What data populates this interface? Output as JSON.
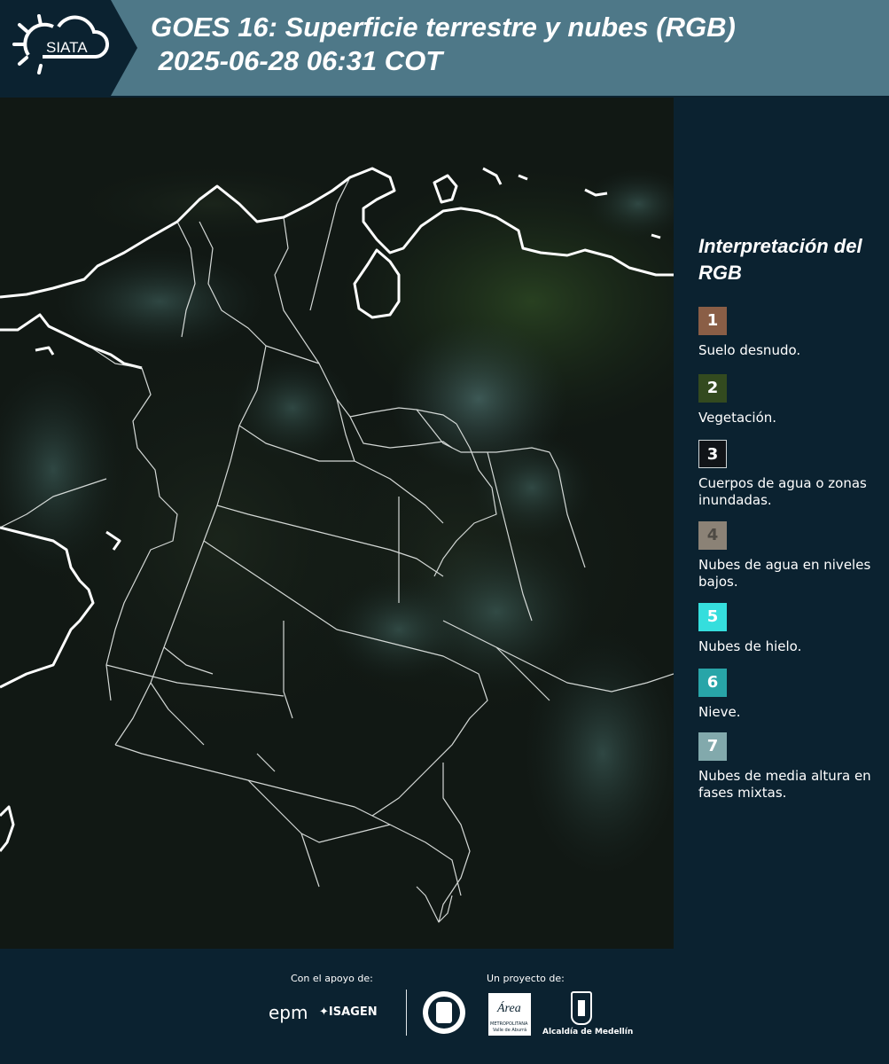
{
  "header": {
    "logo_text": "SIATA",
    "title_line1": "GOES 16: Superficie terrestre y nubes (RGB)",
    "title_line2": " 2025-06-28 06:31 COT"
  },
  "legend": {
    "title": "Interpretación del RGB",
    "items": [
      {
        "num": "1",
        "label": "Suelo desnudo.",
        "color": "#8a5e46"
      },
      {
        "num": "2",
        "label": "Vegetación.",
        "color": "#334a1f"
      },
      {
        "num": "3",
        "label": "Cuerpos de agua o zonas inundadas.",
        "color": "#111418"
      },
      {
        "num": "4",
        "label": "Nubes de agua en niveles bajos.",
        "color": "#8b8276"
      },
      {
        "num": "5",
        "label": "Nubes de hielo.",
        "color": "#35dedd"
      },
      {
        "num": "6",
        "label": "Nieve.",
        "color": "#28a5a8"
      },
      {
        "num": "7",
        "label": "Nubes de media altura en fases mixtas.",
        "color": "#82a9ac"
      }
    ]
  },
  "footer": {
    "support_label": "Con el apoyo de:",
    "project_label": "Un proyecto de:",
    "sponsor_epm": "epm",
    "sponsor_isagen": "ISAGEN",
    "area_text": "Área",
    "area_sub": "METROPOLITANA",
    "area_sub2": "Valle de Aburrá",
    "alcaldia": "Alcaldía de Medellín"
  },
  "colors": {
    "header_bg": "#4e7888",
    "panel_bg": "#0b2230",
    "map_bg": "#101713"
  }
}
